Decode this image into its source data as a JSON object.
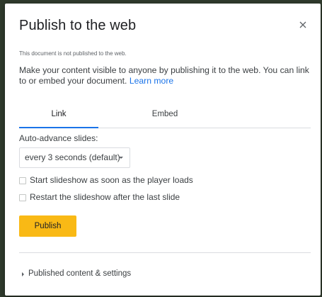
{
  "dialog": {
    "title": "Publish to the web",
    "close_icon": "close-icon",
    "status_text": "This document is not published to the web.",
    "description_text": "Make your content visible to anyone by publishing it to the web. You can link to or embed your document. ",
    "learn_more_label": "Learn more"
  },
  "tabs": [
    {
      "label": "Link",
      "active": true
    },
    {
      "label": "Embed",
      "active": false
    }
  ],
  "link_panel": {
    "auto_advance_label": "Auto-advance slides:",
    "auto_advance_value": "every 3 seconds (default)",
    "start_on_load_label": "Start slideshow as soon as the player loads",
    "start_on_load_checked": false,
    "restart_label": "Restart the slideshow after the last slide",
    "restart_checked": false,
    "publish_label": "Publish"
  },
  "footer": {
    "expander_label": "Published content & settings",
    "expander_icon": "triangle-right-icon"
  },
  "colors": {
    "accent": "#1a73e8",
    "publish_button": "#f9b915",
    "background": "#2f3a2c"
  }
}
